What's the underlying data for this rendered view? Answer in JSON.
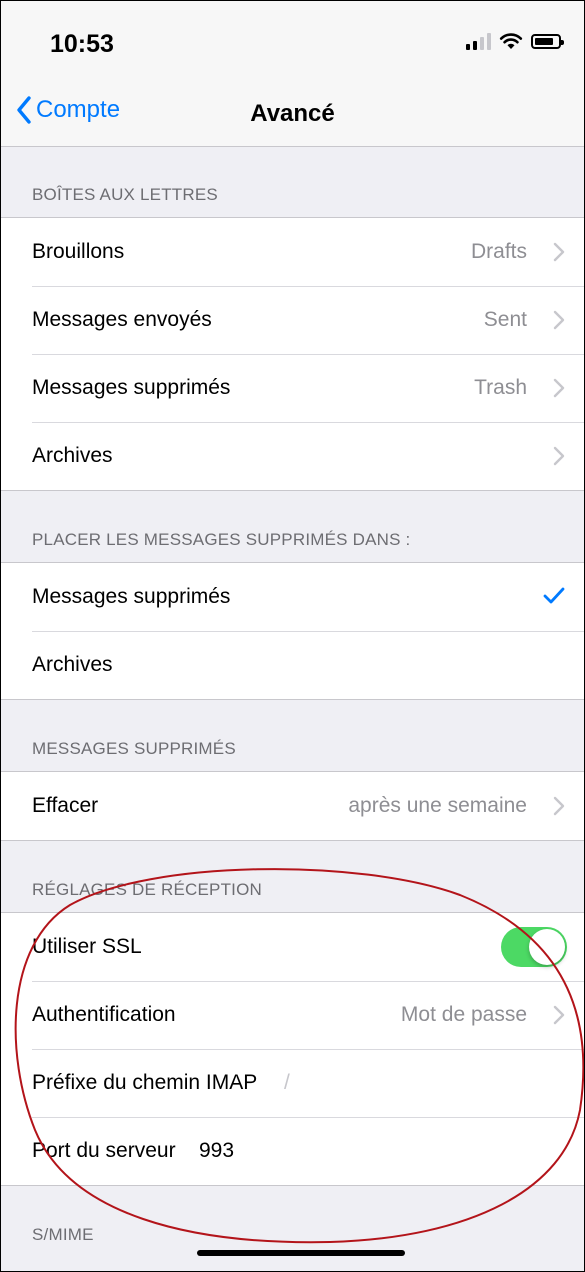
{
  "status_bar": {
    "time": "10:53"
  },
  "nav": {
    "back_label": "Compte",
    "title": "Avancé"
  },
  "sections": [
    {
      "header": "BOÎTES AUX LETTRES",
      "rows": [
        {
          "label": "Brouillons",
          "value": "Drafts"
        },
        {
          "label": "Messages envoyés",
          "value": "Sent"
        },
        {
          "label": "Messages supprimés",
          "value": "Trash"
        },
        {
          "label": "Archives",
          "value": ""
        }
      ]
    },
    {
      "header": "PLACER LES MESSAGES SUPPRIMÉS DANS :",
      "rows": [
        {
          "label": "Messages supprimés",
          "selected": true
        },
        {
          "label": "Archives",
          "selected": false
        }
      ]
    },
    {
      "header": "MESSAGES SUPPRIMÉS",
      "rows": [
        {
          "label": "Effacer",
          "value": "après une semaine"
        }
      ]
    },
    {
      "header": "RÉGLAGES DE RÉCEPTION",
      "rows": [
        {
          "label": "Utiliser SSL",
          "toggle_on": true
        },
        {
          "label": "Authentification",
          "value": "Mot de passe"
        },
        {
          "label": "Préfixe du chemin IMAP",
          "value": "/"
        },
        {
          "label": "Port du serveur",
          "value": "993"
        }
      ]
    },
    {
      "header": "S/MIME"
    }
  ],
  "colors": {
    "accent": "#007aff",
    "toggle_on": "#4cd964",
    "annotation": "#b3141a"
  }
}
